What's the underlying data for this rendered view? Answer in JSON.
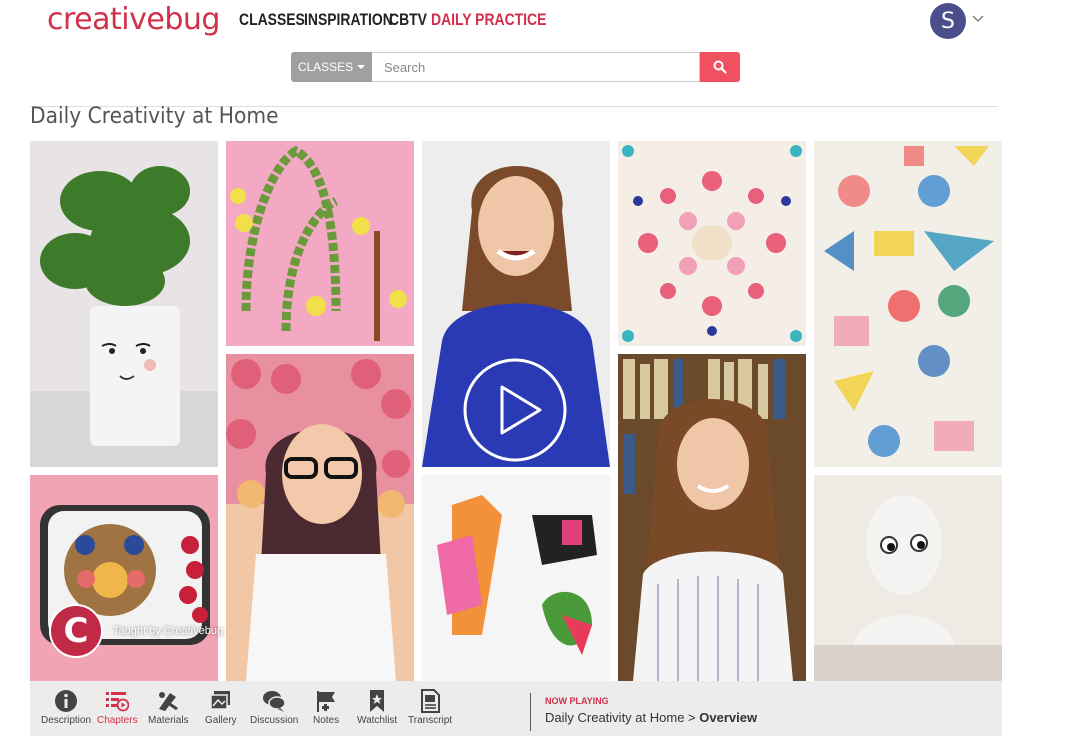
{
  "header": {
    "logo": "creativebug",
    "nav": [
      "CLASSES",
      "INSPIRATION",
      "CBTV",
      "DAILY PRACTICE"
    ],
    "active_nav": "DAILY PRACTICE",
    "avatar_initial": "S",
    "brand_color": "#d0304a"
  },
  "search": {
    "category": "CLASSES",
    "placeholder": "Search"
  },
  "page": {
    "title": "Daily Creativity at Home"
  },
  "video": {
    "taught_by": "Taught by Creativebug",
    "badge_letter": "C"
  },
  "toolbar": {
    "items": [
      {
        "label": "Description",
        "icon": "info-icon"
      },
      {
        "label": "Chapters",
        "icon": "chapters-icon"
      },
      {
        "label": "Materials",
        "icon": "materials-icon"
      },
      {
        "label": "Gallery",
        "icon": "gallery-icon"
      },
      {
        "label": "Discussion",
        "icon": "discussion-icon"
      },
      {
        "label": "Notes",
        "icon": "notes-icon"
      },
      {
        "label": "Watchlist",
        "icon": "watchlist-icon"
      },
      {
        "label": "Transcript",
        "icon": "transcript-icon"
      }
    ],
    "active": "Chapters",
    "now_playing_label": "NOW PLAYING",
    "now_playing_course": "Daily Creativity at Home",
    "now_playing_sep": " > ",
    "now_playing_chapter": "Overview"
  }
}
